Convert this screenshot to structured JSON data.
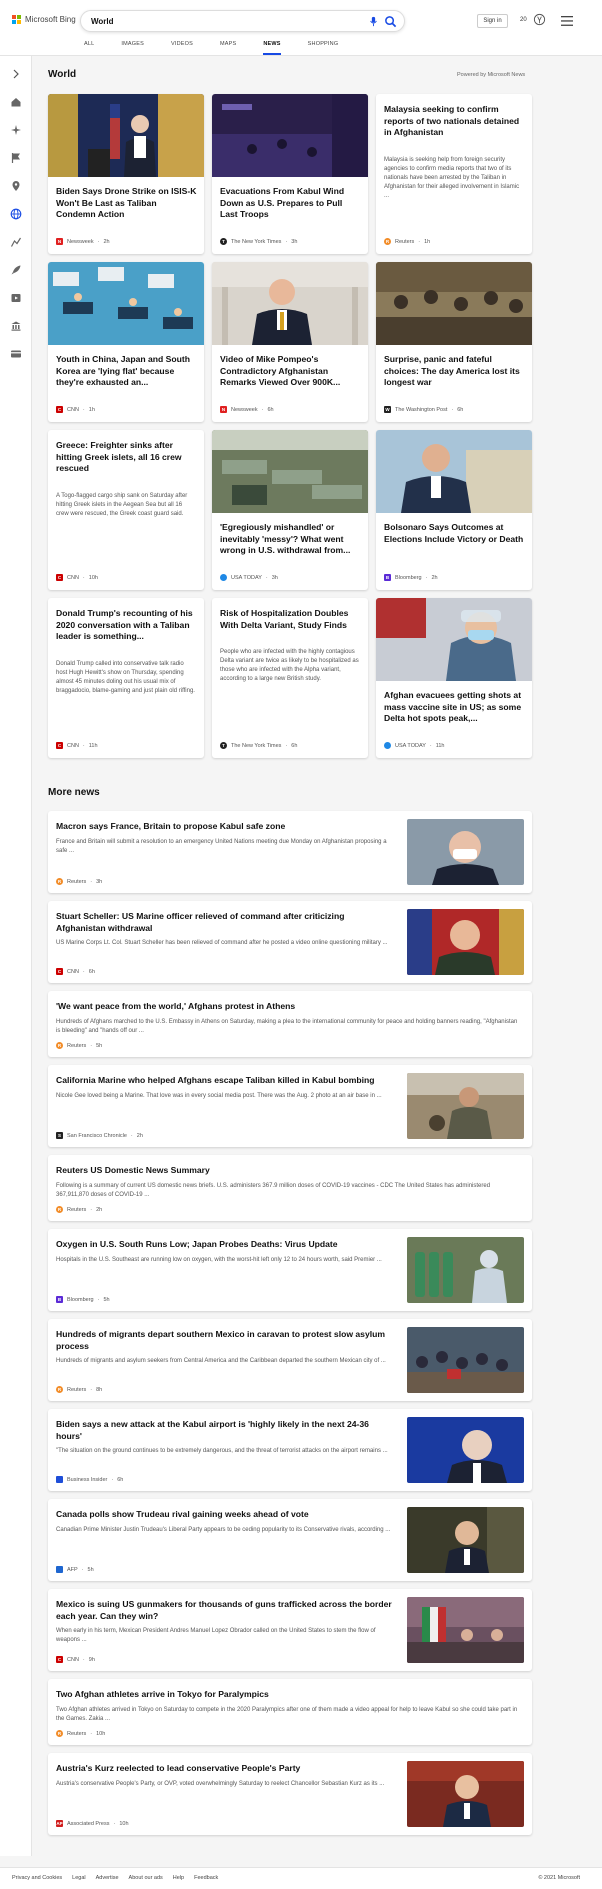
{
  "header": {
    "logo_text": "Microsoft Bing",
    "search_value": "World",
    "sign_in": "Sign in",
    "points": "20"
  },
  "tabs": [
    "ALL",
    "IMAGES",
    "VIDEOS",
    "MAPS",
    "NEWS",
    "SHOPPING"
  ],
  "active_tab": "NEWS",
  "section": {
    "title": "World",
    "powered_by": "Powered by Microsoft News"
  },
  "cards": [
    {
      "title": "Biden Says Drone Strike on ISIS-K Won't Be Last as Taliban Condemn Action",
      "source": "Newsweek",
      "time": "2h",
      "badge": "N",
      "badge_color": "#e02020"
    },
    {
      "title": "Evacuations From Kabul Wind Down as U.S. Prepares to Pull Last Troops",
      "source": "The New York Times",
      "time": "3h",
      "badge": "T",
      "badge_color": "#222222"
    },
    {
      "title": "Malaysia seeking to confirm reports of two nationals detained in Afghanistan",
      "snippet": "Malaysia is seeking help from foreign security agencies to confirm media reports that two of its nationals have been arrested by the Taliban in Afghanistan for their alleged involvement in Islamic ...",
      "source": "Reuters",
      "time": "1h",
      "badge": "R",
      "badge_color": "#f28c28"
    },
    {
      "title": "Youth in China, Japan and South Korea are 'lying flat' because they're exhausted an...",
      "source": "CNN",
      "time": "1h",
      "badge": "C",
      "badge_color": "#cc0000"
    },
    {
      "title": "Video of Mike Pompeo's Contradictory Afghanistan Remarks Viewed Over 900K...",
      "source": "Newsweek",
      "time": "6h",
      "badge": "N",
      "badge_color": "#e02020"
    },
    {
      "title": "Surprise, panic and fateful choices: The day America lost its longest war",
      "source": "The Washington Post",
      "time": "6h",
      "badge": "W",
      "badge_color": "#222222"
    },
    {
      "title": "Greece: Freighter sinks after hitting Greek islets, all 16 crew rescued",
      "snippet": "A Togo-flagged cargo ship sank on Saturday after hitting Greek islets in the Aegean Sea but all 16 crew were rescued, the Greek coast guard said.",
      "source": "CNN",
      "time": "10h",
      "badge": "C",
      "badge_color": "#cc0000"
    },
    {
      "title": "'Egregiously mishandled' or inevitably 'messy'? What went wrong in U.S. withdrawal from...",
      "source": "USA TODAY",
      "time": "3h",
      "badge": "",
      "badge_color": "#1e88e5"
    },
    {
      "title": "Bolsonaro Says Outcomes at Elections Include Victory or Death",
      "source": "Bloomberg",
      "time": "2h",
      "badge": "B",
      "badge_color": "#5b2bd6"
    },
    {
      "title": "Donald Trump's recounting of his 2020 conversation with a Taliban leader is something...",
      "snippet": "Donald Trump called into conservative talk radio host Hugh Hewitt's show on Thursday, spending almost 45 minutes doling out his usual mix of braggadocio, blame-gaming and just plain old riffing.",
      "source": "CNN",
      "time": "11h",
      "badge": "C",
      "badge_color": "#cc0000"
    },
    {
      "title": "Risk of Hospitalization Doubles With Delta Variant, Study Finds",
      "snippet": "People who are infected with the highly contagious Delta variant are twice as likely to be hospitalized as those who are infected with the Alpha variant, according to a large new British study.",
      "source": "The New York Times",
      "time": "6h",
      "badge": "T",
      "badge_color": "#222222"
    },
    {
      "title": "Afghan evacuees getting shots at mass vaccine site in US; as some Delta hot spots peak,...",
      "source": "USA TODAY",
      "time": "11h",
      "badge": "",
      "badge_color": "#1e88e5"
    }
  ],
  "more_title": "More news",
  "more": [
    {
      "title": "Macron says France, Britain to propose Kabul safe zone",
      "snippet": "France and Britain will submit a resolution to an emergency United Nations meeting due Monday on Afghanistan proposing a safe ...",
      "source": "Reuters",
      "time": "3h",
      "badge": "R",
      "badge_color": "#f28c28"
    },
    {
      "title": "Stuart Scheller: US Marine officer relieved of command after criticizing Afghanistan withdrawal",
      "snippet": "US Marine Corps Lt. Col. Stuart Scheller has been relieved of command after he posted a video online questioning military ...",
      "source": "CNN",
      "time": "6h",
      "badge": "C",
      "badge_color": "#cc0000"
    },
    {
      "title": "'We want peace from the world,' Afghans protest in Athens",
      "snippet": "Hundreds of Afghans marched to the U.S. Embassy in Athens on Saturday, making a plea to the international community for peace and holding banners reading, \"Afghanistan is bleeding\" and \"hands off our ...",
      "source": "Reuters",
      "time": "5h",
      "badge": "R",
      "badge_color": "#f28c28"
    },
    {
      "title": "California Marine who helped Afghans escape Taliban killed in Kabul bombing",
      "snippet": "Nicole Gee loved being a Marine. That love was in every social media post. There was the Aug. 2 photo at an air base in ...",
      "source": "San Francisco Chronicle",
      "time": "2h",
      "badge": "S",
      "badge_color": "#222222"
    },
    {
      "title": "Reuters US Domestic News Summary",
      "snippet": "Following is a summary of current US domestic news briefs. U.S. administers 367.9 million doses of COVID-19 vaccines - CDC The United States has administered 367,911,870 doses of COVID-19 ...",
      "source": "Reuters",
      "time": "2h",
      "badge": "R",
      "badge_color": "#f28c28"
    },
    {
      "title": "Oxygen in U.S. South Runs Low; Japan Probes Deaths: Virus Update",
      "snippet": "Hospitals in the U.S. Southeast are running low on oxygen, with the worst-hit left only 12 to 24 hours worth, said Premier ...",
      "source": "Bloomberg",
      "time": "5h",
      "badge": "B",
      "badge_color": "#5b2bd6"
    },
    {
      "title": "Hundreds of migrants depart southern Mexico in caravan to protest slow asylum process",
      "snippet": "Hundreds of migrants and asylum seekers from Central America and the Caribbean departed the southern Mexican city of ...",
      "source": "Reuters",
      "time": "8h",
      "badge": "R",
      "badge_color": "#f28c28"
    },
    {
      "title": "Biden says a new attack at the Kabul airport is 'highly likely in the next 24-36 hours'",
      "snippet": "\"The situation on the ground continues to be extremely dangerous, and the threat of terrorist attacks on the airport remains ...",
      "source": "Business Insider",
      "time": "6h",
      "badge": "",
      "badge_color": "#1e4ed8"
    },
    {
      "title": "Canada polls show Trudeau rival gaining weeks ahead of vote",
      "snippet": "Canadian Prime Minister Justin Trudeau's Liberal Party appears to be ceding popularity to its Conservative rivals, according ...",
      "source": "AFP",
      "time": "5h",
      "badge": "",
      "badge_color": "#1e66d0"
    },
    {
      "title": "Mexico is suing US gunmakers for thousands of guns trafficked across the border each year. Can they win?",
      "snippet": "When early in his term, Mexican President Andres Manuel Lopez Obrador called on the United States to stem the flow of weapons ...",
      "source": "CNN",
      "time": "9h",
      "badge": "C",
      "badge_color": "#cc0000"
    },
    {
      "title": "Two Afghan athletes arrive in Tokyo for Paralympics",
      "snippet": "Two Afghan athletes arrived in Tokyo on Saturday to compete in the 2020 Paralympics after one of them made a video appeal for help to leave Kabul so she could take part in the Games. Zakia ...",
      "source": "Reuters",
      "time": "10h",
      "badge": "R",
      "badge_color": "#f28c28"
    },
    {
      "title": "Austria's Kurz reelected to lead conservative People's Party",
      "snippet": "Austria's conservative People's Party, or OVP, voted overwhelmingly Saturday to reelect Chancellor Sebastian Kurz as its ...",
      "source": "Associated Press",
      "time": "10h",
      "badge": "AP",
      "badge_color": "#d01c1c"
    }
  ],
  "footer": {
    "links": [
      "Privacy and Cookies",
      "Legal",
      "Advertise",
      "About our ads",
      "Help",
      "Feedback"
    ],
    "copyright": "© 2021 Microsoft"
  }
}
